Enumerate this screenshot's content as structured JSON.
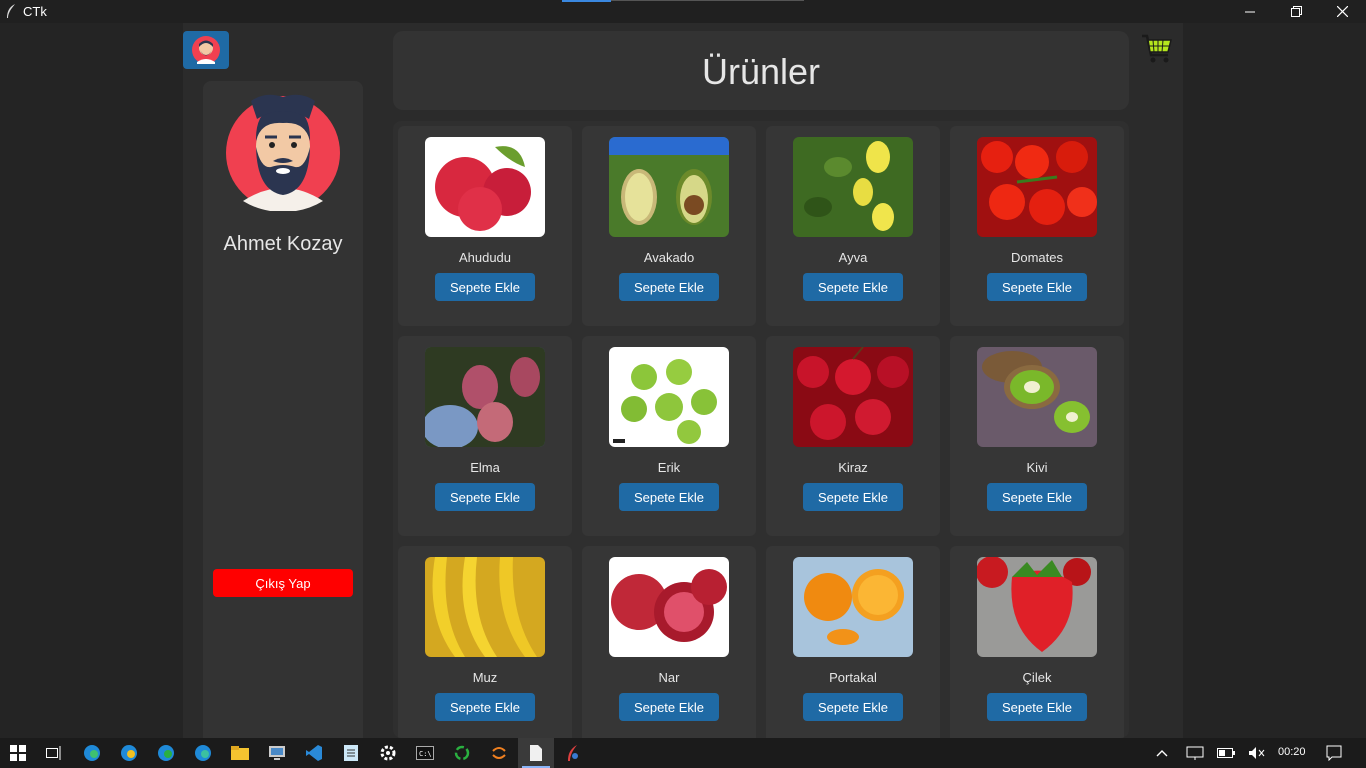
{
  "window": {
    "title": "CTk"
  },
  "header": {
    "title": "Ürünler"
  },
  "profile": {
    "name": "Ahmet Kozay",
    "logout_label": "Çıkış Yap"
  },
  "products": [
    {
      "name": "Ahududu",
      "button": "Sepete Ekle"
    },
    {
      "name": "Avakado",
      "button": "Sepete Ekle"
    },
    {
      "name": "Ayva",
      "button": "Sepete Ekle"
    },
    {
      "name": "Domates",
      "button": "Sepete Ekle"
    },
    {
      "name": "Elma",
      "button": "Sepete Ekle"
    },
    {
      "name": "Erik",
      "button": "Sepete Ekle"
    },
    {
      "name": "Kiraz",
      "button": "Sepete Ekle"
    },
    {
      "name": "Kivi",
      "button": "Sepete Ekle"
    },
    {
      "name": "Muz",
      "button": "Sepete Ekle"
    },
    {
      "name": "Nar",
      "button": "Sepete Ekle"
    },
    {
      "name": "Portakal",
      "button": "Sepete Ekle"
    },
    {
      "name": "Çilek",
      "button": "Sepete Ekle"
    }
  ],
  "taskbar": {
    "time": "00:20",
    "apps": [
      "edge-beta-icon",
      "edge-canary-icon",
      "edge-dev-icon",
      "edge-icon",
      "file-explorer-icon",
      "remote-desktop-icon",
      "vscode-icon",
      "notepad-icon",
      "settings-icon",
      "terminal-icon",
      "spinner-app-icon",
      "sync-app-icon",
      "document-icon",
      "python-feather-icon"
    ]
  },
  "colors": {
    "accent": "#1f6aa5",
    "logout": "#ff0000"
  }
}
